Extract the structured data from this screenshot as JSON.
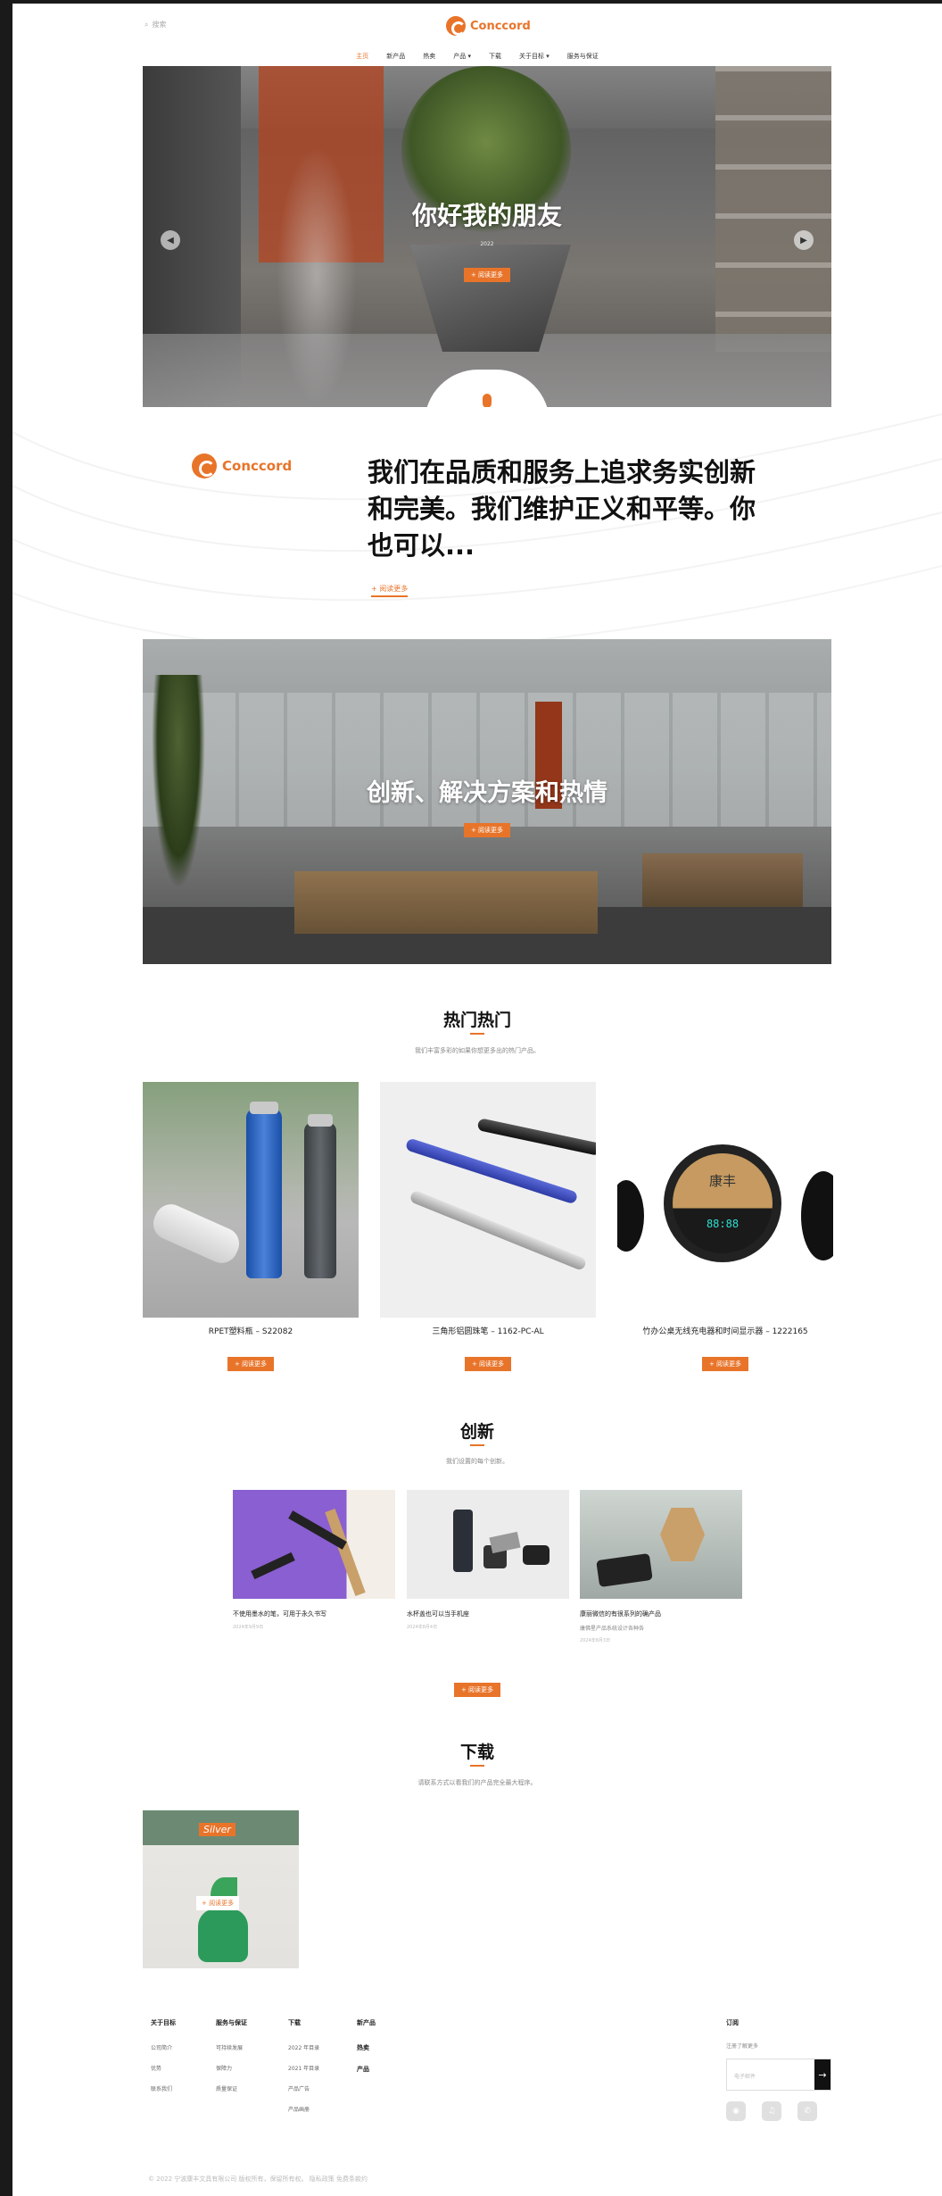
{
  "header": {
    "search_label": "搜索",
    "brand": "Conccord",
    "nav": [
      {
        "label": "主页"
      },
      {
        "label": "新产品"
      },
      {
        "label": "热卖"
      },
      {
        "label": "产品 ▾"
      },
      {
        "label": "下载"
      },
      {
        "label": "关于目标 ▾"
      },
      {
        "label": "服务与保证"
      }
    ]
  },
  "hero": {
    "title": "你好我的朋友",
    "small_text": "2022",
    "button": "+ 阅读更多",
    "prev": "◀",
    "next": "▶"
  },
  "intro": {
    "brand": "Conccord",
    "text": "我们在品质和服务上追求务实创新和完美。我们维护正义和平等。你也可以...",
    "link": "+ 阅读更多"
  },
  "banner2": {
    "title": "创新、解决方案和热情",
    "button": "+ 阅读更多"
  },
  "hot": {
    "title": "热门热门",
    "subtitle": "我们丰富多彩的如果你想更多出的热门产品。",
    "products": [
      {
        "name": "RPET塑料瓶 – S22082",
        "button": "+ 阅读更多"
      },
      {
        "name": "三角形铝圆珠笔 – 1162-PC-AL",
        "button": "+ 阅读更多"
      },
      {
        "name": "竹办公桌无线充电器和时间显示器 – 1222165",
        "button": "+ 阅读更多"
      }
    ],
    "clock_brand": "康丰",
    "clock_time": "88:88"
  },
  "innovation": {
    "title": "创新",
    "subtitle": "我们设置的每个创新。",
    "items": [
      {
        "title": "不使用墨水的笔，可用于永久书写",
        "desc": "",
        "meta": "2024年9月9日"
      },
      {
        "title": "水杯盖也可以当手机座",
        "desc": "",
        "meta": "2024年8月4日"
      },
      {
        "title": "康丽微信的有很系列的确产品",
        "desc": "康佛星产品系统设计各种各",
        "meta": "2024年8月3日"
      }
    ],
    "button": "+ 阅读更多"
  },
  "download": {
    "title": "下载",
    "subtitle": "请联系方式以看我们的产品完全最大程序。",
    "brand_label": "Silver",
    "overlay": "+ 阅读更多"
  },
  "footer": {
    "columns": [
      {
        "heading": "关于目标",
        "items": [
          "公司简介",
          "优势",
          "联系我们"
        ]
      },
      {
        "heading": "服务与保证",
        "items": [
          "可持续发展",
          "保障力",
          "质量保证"
        ]
      },
      {
        "heading": "下载",
        "items": [
          "2022 年目录",
          "2021 年目录",
          "产品广告",
          "产品画册"
        ]
      },
      {
        "heading": "新产品",
        "bold_items": [
          "热卖",
          "产品"
        ]
      }
    ],
    "subscribe": {
      "heading": "订阅",
      "sub": "注册了解更多",
      "placeholder": "电子邮件",
      "go": "→"
    },
    "socials": [
      "◉",
      "♫",
      "✆"
    ],
    "copyright": "© 2022 宁波康丰文具有限公司 版权所有，保留所有权。 隐私政策 免费条款约"
  },
  "colors": {
    "accent": "#e8742a"
  }
}
